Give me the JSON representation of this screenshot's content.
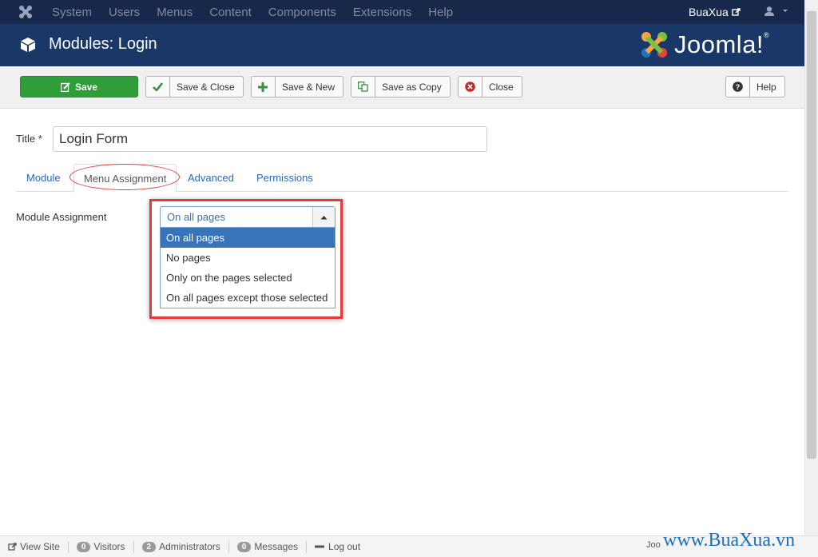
{
  "topnav": {
    "menu": [
      "System",
      "Users",
      "Menus",
      "Content",
      "Components",
      "Extensions",
      "Help"
    ],
    "site_name": "BuaXua"
  },
  "header": {
    "title": "Modules: Login",
    "brand": "Joomla!"
  },
  "toolbar": {
    "save": "Save",
    "save_close": "Save & Close",
    "save_new": "Save & New",
    "save_copy": "Save as Copy",
    "close": "Close",
    "help": "Help"
  },
  "form": {
    "title_label": "Title *",
    "title_value": "Login Form",
    "tabs": [
      "Module",
      "Menu Assignment",
      "Advanced",
      "Permissions"
    ],
    "active_tab": "Menu Assignment",
    "assignment_label": "Module Assignment",
    "assignment_selected": "On all pages",
    "assignment_options": [
      "On all pages",
      "No pages",
      "Only on the pages selected",
      "On all pages except those selected"
    ]
  },
  "statusbar": {
    "view_site": "View Site",
    "visitors_count": "0",
    "visitors": "Visitors",
    "admins_count": "2",
    "admins": "Administrators",
    "messages_count": "0",
    "messages": "Messages",
    "logout": "Log out",
    "joomla_version": "Joo"
  },
  "watermark": "www.BuaXua.vn",
  "colors": {
    "topnav": "#17284a",
    "header": "#1a3867",
    "save_green": "#2f9e38",
    "link_blue": "#2a69b8",
    "highlight_red": "#e53a3a"
  }
}
